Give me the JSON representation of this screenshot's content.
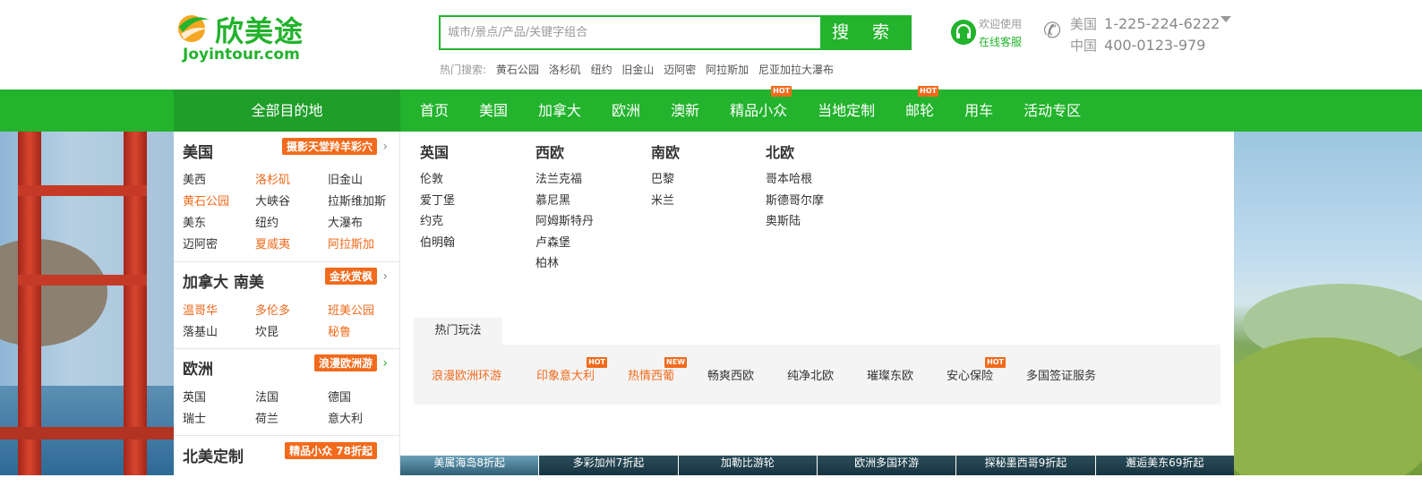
{
  "logo": {
    "cn": "欣美途",
    "en": "Joyintour.com"
  },
  "search": {
    "placeholder": "城市/景点/产品/关键字组合",
    "button": "搜 索"
  },
  "hot_search": {
    "label": "热门搜索:",
    "keywords": [
      "黄石公园",
      "洛杉矶",
      "纽约",
      "旧金山",
      "迈阿密",
      "阿拉斯加",
      "尼亚加拉大瀑布"
    ]
  },
  "service": {
    "line1": "欢迎使用",
    "line2": "在线客服",
    "icon": "headset-icon"
  },
  "phones": [
    {
      "country": "美国",
      "number": "1-225-224-6222"
    },
    {
      "country": "中国",
      "number": "400-0123-979"
    }
  ],
  "nav": {
    "all": "全部目的地",
    "items": [
      {
        "label": "首页",
        "badge": ""
      },
      {
        "label": "美国",
        "badge": ""
      },
      {
        "label": "加拿大",
        "badge": ""
      },
      {
        "label": "欧洲",
        "badge": ""
      },
      {
        "label": "澳新",
        "badge": ""
      },
      {
        "label": "精品小众",
        "badge": "HOT"
      },
      {
        "label": "当地定制",
        "badge": ""
      },
      {
        "label": "邮轮",
        "badge": "HOT"
      },
      {
        "label": "用车",
        "badge": ""
      },
      {
        "label": "活动专区",
        "badge": ""
      }
    ]
  },
  "sidebar": {
    "sections": [
      {
        "title": "美国",
        "tag": "摄影天堂羚羊彩穴",
        "links": [
          {
            "text": "美西",
            "hot": false
          },
          {
            "text": "洛杉矶",
            "hot": true
          },
          {
            "text": "旧金山",
            "hot": false
          },
          {
            "text": "黄石公园",
            "hot": true
          },
          {
            "text": "大峡谷",
            "hot": false
          },
          {
            "text": "拉斯维加斯",
            "hot": false
          },
          {
            "text": "美东",
            "hot": false
          },
          {
            "text": "纽约",
            "hot": false
          },
          {
            "text": "大瀑布",
            "hot": false
          },
          {
            "text": "迈阿密",
            "hot": false
          },
          {
            "text": "夏威夷",
            "hot": true
          },
          {
            "text": "阿拉斯加",
            "hot": true
          }
        ]
      },
      {
        "title": "加拿大 南美",
        "tag": "金秋赏枫",
        "links": [
          {
            "text": "温哥华",
            "hot": true
          },
          {
            "text": "多伦多",
            "hot": true
          },
          {
            "text": "班美公园",
            "hot": true
          },
          {
            "text": "落基山",
            "hot": false
          },
          {
            "text": "坎昆",
            "hot": false
          },
          {
            "text": "秘鲁",
            "hot": true
          }
        ]
      },
      {
        "title": "欧洲",
        "tag": "浪漫欧洲游",
        "links": [
          {
            "text": "英国",
            "hot": false
          },
          {
            "text": "法国",
            "hot": false
          },
          {
            "text": "德国",
            "hot": false
          },
          {
            "text": "瑞士",
            "hot": false
          },
          {
            "text": "荷兰",
            "hot": false
          },
          {
            "text": "意大利",
            "hot": false
          }
        ]
      },
      {
        "title": "北美定制",
        "tag": "精品小众 78折起",
        "links": []
      }
    ]
  },
  "panel": {
    "regions": [
      {
        "title": "英国",
        "cities": [
          "伦敦",
          "爱丁堡",
          "约克",
          "伯明翰"
        ]
      },
      {
        "title": "西欧",
        "cities": [
          "法兰克福",
          "慕尼黑",
          "阿姆斯特丹",
          "卢森堡",
          "柏林"
        ]
      },
      {
        "title": "南欧",
        "cities": [
          "巴黎",
          "米兰"
        ]
      },
      {
        "title": "北欧",
        "cities": [
          "哥本哈根",
          "斯德哥尔摩",
          "奥斯陆"
        ]
      }
    ],
    "hot_tab": "热门玩法",
    "hot_items": [
      {
        "text": "浪漫欧洲环游",
        "orange": true,
        "badge": ""
      },
      {
        "text": "印象意大利",
        "orange": true,
        "badge": "HOT"
      },
      {
        "text": "热情西葡",
        "orange": true,
        "badge": "NEW"
      },
      {
        "text": "畅爽西欧",
        "orange": false,
        "badge": ""
      },
      {
        "text": "纯净北欧",
        "orange": false,
        "badge": ""
      },
      {
        "text": "璀璨东欧",
        "orange": false,
        "badge": ""
      },
      {
        "text": "安心保险",
        "orange": false,
        "badge": "HOT"
      },
      {
        "text": "多国签证服务",
        "orange": false,
        "badge": ""
      }
    ]
  },
  "bottom_strip": [
    "美属海岛8折起",
    "多彩加州7折起",
    "加勒比游轮",
    "欧洲多国环游",
    "探秘墨西哥9折起",
    "邂逅美东69折起"
  ],
  "colors": {
    "brand_green": "#23b32d",
    "dark_green": "#1f9e2a",
    "orange": "#f26a1b"
  }
}
